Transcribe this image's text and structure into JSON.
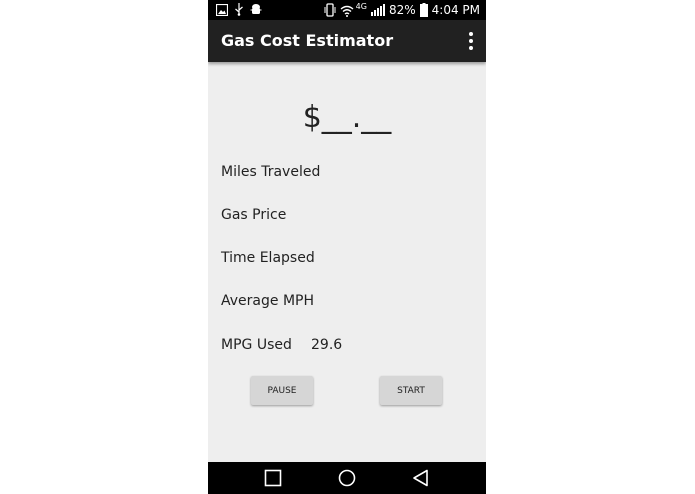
{
  "status_bar": {
    "battery": "82%",
    "time": "4:04 PM",
    "network": "4G"
  },
  "app_bar": {
    "title": "Gas Cost Estimator"
  },
  "main": {
    "cost": "$__.__",
    "rows": [
      {
        "label": "Miles Traveled",
        "value": ""
      },
      {
        "label": "Gas Price",
        "value": ""
      },
      {
        "label": "Time Elapsed",
        "value": ""
      },
      {
        "label": "Average MPH",
        "value": ""
      },
      {
        "label": "MPG Used",
        "value": "29.6"
      }
    ],
    "pause_label": "PAUSE",
    "start_label": "START"
  },
  "icons": {
    "status_left": [
      "image-icon",
      "usb-icon",
      "android-debug-icon"
    ],
    "status_right": [
      "vibrate-icon",
      "wifi-icon",
      "signal-icon",
      "battery-icon"
    ],
    "app_bar": [
      "overflow-menu-icon"
    ],
    "nav": [
      "recent-apps-icon",
      "home-icon",
      "back-icon"
    ]
  },
  "colors": {
    "app_bar": "#212121",
    "background": "#eeeeee",
    "button": "#d6d6d6"
  }
}
